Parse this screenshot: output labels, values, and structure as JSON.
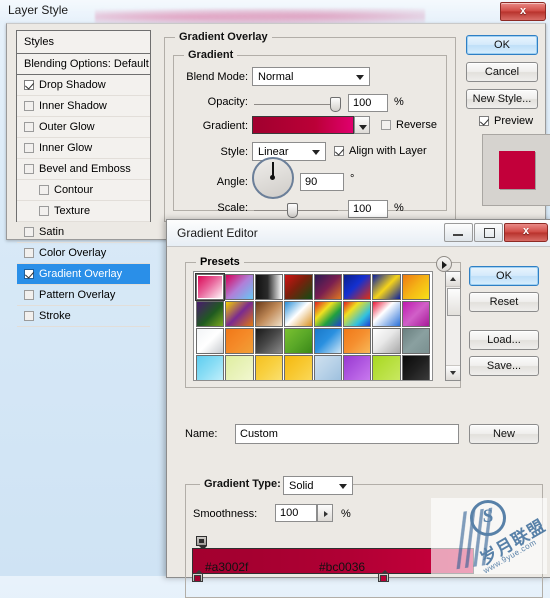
{
  "window": {
    "title": "Layer Style",
    "close_label": "x"
  },
  "styles_panel": {
    "header": "Styles",
    "blending_options": "Blending Options: Default",
    "items": [
      {
        "label": "Drop Shadow",
        "checked": true,
        "indent": false,
        "selected": false
      },
      {
        "label": "Inner Shadow",
        "checked": false,
        "indent": false,
        "selected": false
      },
      {
        "label": "Outer Glow",
        "checked": false,
        "indent": false,
        "selected": false
      },
      {
        "label": "Inner Glow",
        "checked": false,
        "indent": false,
        "selected": false
      },
      {
        "label": "Bevel and Emboss",
        "checked": false,
        "indent": false,
        "selected": false
      },
      {
        "label": "Contour",
        "checked": false,
        "indent": true,
        "selected": false
      },
      {
        "label": "Texture",
        "checked": false,
        "indent": true,
        "selected": false
      },
      {
        "label": "Satin",
        "checked": false,
        "indent": false,
        "selected": false
      },
      {
        "label": "Color Overlay",
        "checked": false,
        "indent": false,
        "selected": false
      },
      {
        "label": "Gradient Overlay",
        "checked": true,
        "indent": false,
        "selected": true
      },
      {
        "label": "Pattern Overlay",
        "checked": false,
        "indent": false,
        "selected": false
      },
      {
        "label": "Stroke",
        "checked": false,
        "indent": false,
        "selected": false
      }
    ]
  },
  "gradient_overlay": {
    "section_title": "Gradient Overlay",
    "group_title": "Gradient",
    "blend_mode_label": "Blend Mode:",
    "blend_mode_value": "Normal",
    "opacity_label": "Opacity:",
    "opacity_value": "100",
    "opacity_unit": "%",
    "gradient_label": "Gradient:",
    "reverse_label": "Reverse",
    "reverse_checked": false,
    "style_label": "Style:",
    "style_value": "Linear",
    "align_label": "Align with Layer",
    "align_checked": true,
    "angle_label": "Angle:",
    "angle_value": "90",
    "angle_unit": "°",
    "scale_label": "Scale:",
    "scale_value": "100",
    "scale_unit": "%",
    "gradient_css": "linear-gradient(90deg,#a3002f 0%,#a3002f 6%,#bb0037 62%,#e0006e 100%)"
  },
  "layer_style_buttons": {
    "ok": "OK",
    "cancel": "Cancel",
    "new_style": "New Style...",
    "preview_label": "Preview",
    "preview_checked": true,
    "preview_color": "#c2003a"
  },
  "gradient_editor": {
    "title": "Gradient Editor",
    "minimize_label": "minimize",
    "maximize_label": "maximize",
    "close_label": "x",
    "presets_title": "Presets",
    "buttons": {
      "ok": "OK",
      "reset": "Reset",
      "load": "Load...",
      "save": "Save...",
      "new": "New"
    },
    "name_label": "Name:",
    "name_value": "Custom",
    "gradient_type_label": "Gradient Type:",
    "gradient_type_value": "Solid",
    "smoothness_label": "Smoothness:",
    "smoothness_value": "100",
    "smoothness_unit": "%",
    "stop_left_hex": "#a3002f",
    "stop_right_hex": "#bc0036",
    "stop_bar_css": "linear-gradient(90deg,#a3002f 0%,#a50030 20%,#b00034 55%,#c00039 82%,#cf0041 100%)",
    "presets": [
      "linear-gradient(135deg,#d8004f 0%,#e8639a 45%,#ffffff 100%)",
      "linear-gradient(135deg,#d8005a 0%,#b07fd8 50%,#66c8f5 100%)",
      "linear-gradient(90deg,#111111 0%,#2b2b2b 45%,#ffffff 100%)",
      "linear-gradient(135deg,#d01414 0%,#7b1f0c 45%,#114d14 100%)",
      "linear-gradient(135deg,#2b1a55 0%,#7a1f50 50%,#e07820 100%)",
      "linear-gradient(135deg,#0c1f8a 0%,#1430d0 45%,#e03010 100%)",
      "linear-gradient(135deg,#0a1fa0 0%,#f5d31a 50%,#0a1fa0 100%)",
      "linear-gradient(135deg,#ee7a12 0%,#f5b516 50%,#f7e018 100%)",
      "linear-gradient(135deg,#4a1a6e 0%,#1f5a20 55%,#7aa81e 100%)",
      "linear-gradient(135deg,#f5d000 0%,#7a2a90 50%,#e07a10 100%)",
      "linear-gradient(135deg,#6b3a18 0%,#c08a58 50%,#f0e0c8 100%)",
      "linear-gradient(135deg,#2a8fd8 0%,#ffffff 48%,#d89020 100%)",
      "linear-gradient(135deg,#e02020 0%,#f0e020 35%,#20a040 65%,#2040d0 100%)",
      "linear-gradient(135deg,#e02020 0%,#f0e020 30%,#30c0e0 70%,#2040d0 100%)",
      "linear-gradient(135deg,#e81a3a 0%,#ffffff 40%,#2a70d8 100%)",
      "linear-gradient(135deg,#c01ab0 0%,#d060c8 50%,#a81a98 100%)",
      "linear-gradient(135deg,#f2f4f6 0%,#ffffff 50%,#c8ccd0 100%)",
      "linear-gradient(135deg,#f07818 0%,#f58a28 50%,#f0a038 100%)",
      "linear-gradient(135deg,#1a1a1a 0%,#4a4a4a 50%,#8a8a8a 100%)",
      "linear-gradient(135deg,#7ac030 0%,#5aa828 50%,#3a8818 100%)",
      "linear-gradient(135deg,#1a78c8 0%,#2a90e0 45%,#cfe6f5 100%)",
      "linear-gradient(135deg,#f07818 0%,#f59030 50%,#f8b858 100%)",
      "linear-gradient(135deg,#ffffff 0%,#e8e8e8 45%,#a8a8a8 100%)",
      "linear-gradient(135deg,#6a8080 0%,#8aa0a0 50%,#7a9090 100%)",
      "linear-gradient(135deg,#5ecdf0 0%,#8addf5 50%,#bfeefb 100%)",
      "linear-gradient(135deg,#dfeea0 0%,#e8f2b8 50%,#f2f8d0 100%)",
      "linear-gradient(135deg,#f5c020 0%,#f8d040 50%,#fae070 100%)",
      "linear-gradient(135deg,#f5b810 0%,#f8c830 50%,#fad858 100%)",
      "linear-gradient(135deg,#cfe0ee 0%,#b8d2e8 50%,#9ec0de 100%)",
      "linear-gradient(135deg,#9838d0 0%,#b058e0 50%,#c878ee 100%)",
      "linear-gradient(135deg,#a8d820 0%,#b8e040 50%,#c8e860 100%)",
      "linear-gradient(135deg,#0a0a0a 0%,#1f1f1f 50%,#3a3a3a 100%)"
    ]
  },
  "watermark": {
    "mark": "S",
    "text": "岁月联盟",
    "url": "www.9yue.com"
  }
}
